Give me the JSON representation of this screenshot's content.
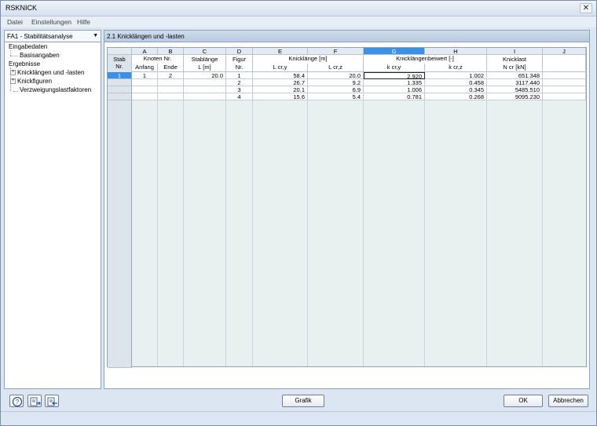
{
  "window": {
    "title": "RSKNICK"
  },
  "menu": [
    "Datei",
    "Einstellungen",
    "Hilfe"
  ],
  "left": {
    "combo_value": "FA1 - Stabilitätsanalyse",
    "tree": [
      {
        "label": "Eingabedaten",
        "level": 0,
        "expander": false
      },
      {
        "label": "Basisangaben",
        "level": 1,
        "expander": false
      },
      {
        "label": "Ergebnisse",
        "level": 0,
        "expander": false
      },
      {
        "label": "Knicklängen und -lasten",
        "level": 1,
        "expander": true
      },
      {
        "label": "Knickfiguren",
        "level": 1,
        "expander": true
      },
      {
        "label": "Verzweigungslastfaktoren",
        "level": 1,
        "expander": false
      }
    ]
  },
  "panel": {
    "title": "2.1 Knicklängen und -lasten"
  },
  "table": {
    "column_letters": [
      "A",
      "B",
      "C",
      "D",
      "E",
      "F",
      "G",
      "H",
      "I",
      "J"
    ],
    "active_letter": "G",
    "stab_header": [
      "Stab",
      "Nr."
    ],
    "group_headers": {
      "knoten": "Knoten Nr.",
      "stablaenge": "Stablänge",
      "figur": "Figur",
      "knicklaenge": "Knicklänge [m]",
      "beiwert": "Knicklängenbeiwert [-]",
      "knicklast": "Knicklast"
    },
    "sub_headers": {
      "anfang": "Anfang",
      "ende": "Ende",
      "l": "L [m]",
      "nr": "Nr.",
      "lcry": "L cr,y",
      "lcrz": "L cr,z",
      "kcry": "k cr,y",
      "kcrz": "k cr,z",
      "ncr": "N cr [kN]"
    },
    "rows": [
      {
        "stab": "1",
        "anfang": "1",
        "ende": "2",
        "l": "20.0",
        "figur": "1",
        "lcry": "58.4",
        "lcrz": "20.0",
        "kcry": "2.920",
        "kcrz": "1.002",
        "ncr": "651.348"
      },
      {
        "stab": "",
        "anfang": "",
        "ende": "",
        "l": "",
        "figur": "2",
        "lcry": "26.7",
        "lcrz": "9.2",
        "kcry": "1.335",
        "kcrz": "0.458",
        "ncr": "3117.440"
      },
      {
        "stab": "",
        "anfang": "",
        "ende": "",
        "l": "",
        "figur": "3",
        "lcry": "20.1",
        "lcrz": "6.9",
        "kcry": "1.006",
        "kcrz": "0.345",
        "ncr": "5485.510"
      },
      {
        "stab": "",
        "anfang": "",
        "ende": "",
        "l": "",
        "figur": "4",
        "lcry": "15.6",
        "lcrz": "5.4",
        "kcry": "0.781",
        "kcrz": "0.268",
        "ncr": "9095.230"
      }
    ]
  },
  "buttons": {
    "grafik": "Grafik",
    "ok": "OK",
    "abbrechen": "Abbrechen"
  },
  "icons": [
    "help-icon",
    "export-icon",
    "import-icon"
  ]
}
